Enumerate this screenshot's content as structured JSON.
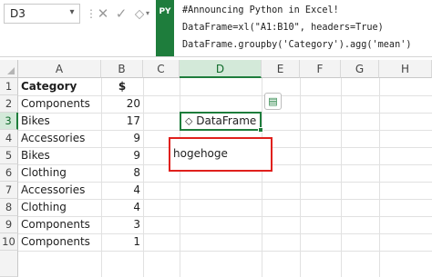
{
  "name_box": {
    "value": "D3",
    "arrow": "▾"
  },
  "toolbar": {
    "separator": "⋮",
    "cancel_icon": "✕",
    "enter_icon": "✓",
    "insert_icon": "⬦"
  },
  "python_badge": "PY",
  "formula_lines": [
    "#Announcing Python in Excel!",
    "DataFrame=xl(\"A1:B10\", headers=True)",
    "DataFrame.groupby('Category').agg('mean')"
  ],
  "columns": [
    "A",
    "B",
    "C",
    "D",
    "E",
    "F",
    "G",
    "H"
  ],
  "selected_column": "D",
  "rows": [
    "1",
    "2",
    "3",
    "4",
    "5",
    "6",
    "7",
    "8",
    "9",
    "10"
  ],
  "selected_row": "3",
  "table": {
    "header": {
      "category": "Category",
      "value": "$"
    },
    "data": [
      {
        "category": "Components",
        "value": "20"
      },
      {
        "category": "Bikes",
        "value": "17"
      },
      {
        "category": "Accessories",
        "value": "9"
      },
      {
        "category": "Bikes",
        "value": "9"
      },
      {
        "category": "Clothing",
        "value": "8"
      },
      {
        "category": "Accessories",
        "value": "4"
      },
      {
        "category": "Clothing",
        "value": "4"
      },
      {
        "category": "Components",
        "value": "3"
      },
      {
        "category": "Components",
        "value": "1"
      }
    ]
  },
  "active_cell": {
    "icon": "⬦",
    "text": "DataFrame"
  },
  "card_icon": "▤",
  "annotation": {
    "text": "hogehoge",
    "color": "#e0201c"
  },
  "colors": {
    "excel_green": "#1e7d3c",
    "selected_header_bg": "#d3e9d9"
  }
}
